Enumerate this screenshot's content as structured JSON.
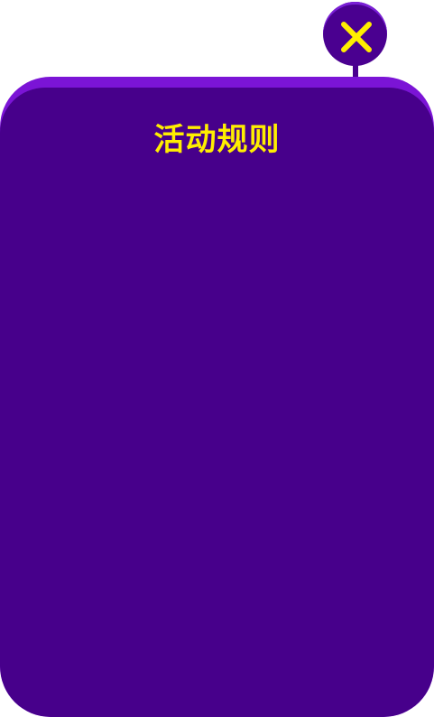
{
  "modal": {
    "title": "活动规则"
  },
  "close_button": {
    "icon": "close-icon"
  },
  "colors": {
    "panel_background": "#47008b",
    "panel_highlight": "#7b14d6",
    "accent_yellow": "#ffee00"
  }
}
